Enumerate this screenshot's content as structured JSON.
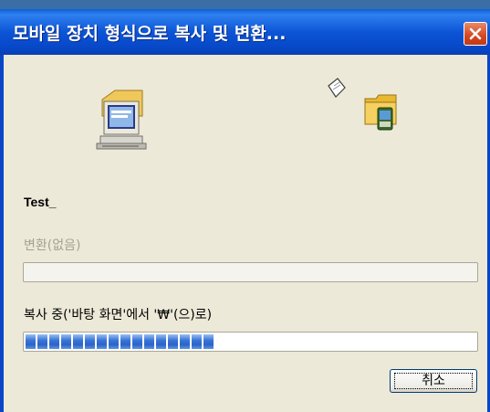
{
  "window": {
    "title": "모바일 장치 형식으로 복사 및 변환...",
    "close_icon": "close-icon"
  },
  "icons": {
    "source": "computer-icon",
    "document": "flying-document-icon",
    "destination": "mobile-device-folder-icon"
  },
  "file": {
    "name": "Test_"
  },
  "conversion": {
    "label": "변환(없음)",
    "progress": 0
  },
  "copy": {
    "label": "복사 중('바탕 화면'에서 '₩'(으)로)",
    "progress": 0.41,
    "segments": 16
  },
  "buttons": {
    "cancel_label": "취소"
  },
  "colors": {
    "title_bar": "#0a5fd8",
    "window_bg": "#ece9d8",
    "progress_fill": "#3a75d8",
    "close_red": "#d5471f"
  }
}
